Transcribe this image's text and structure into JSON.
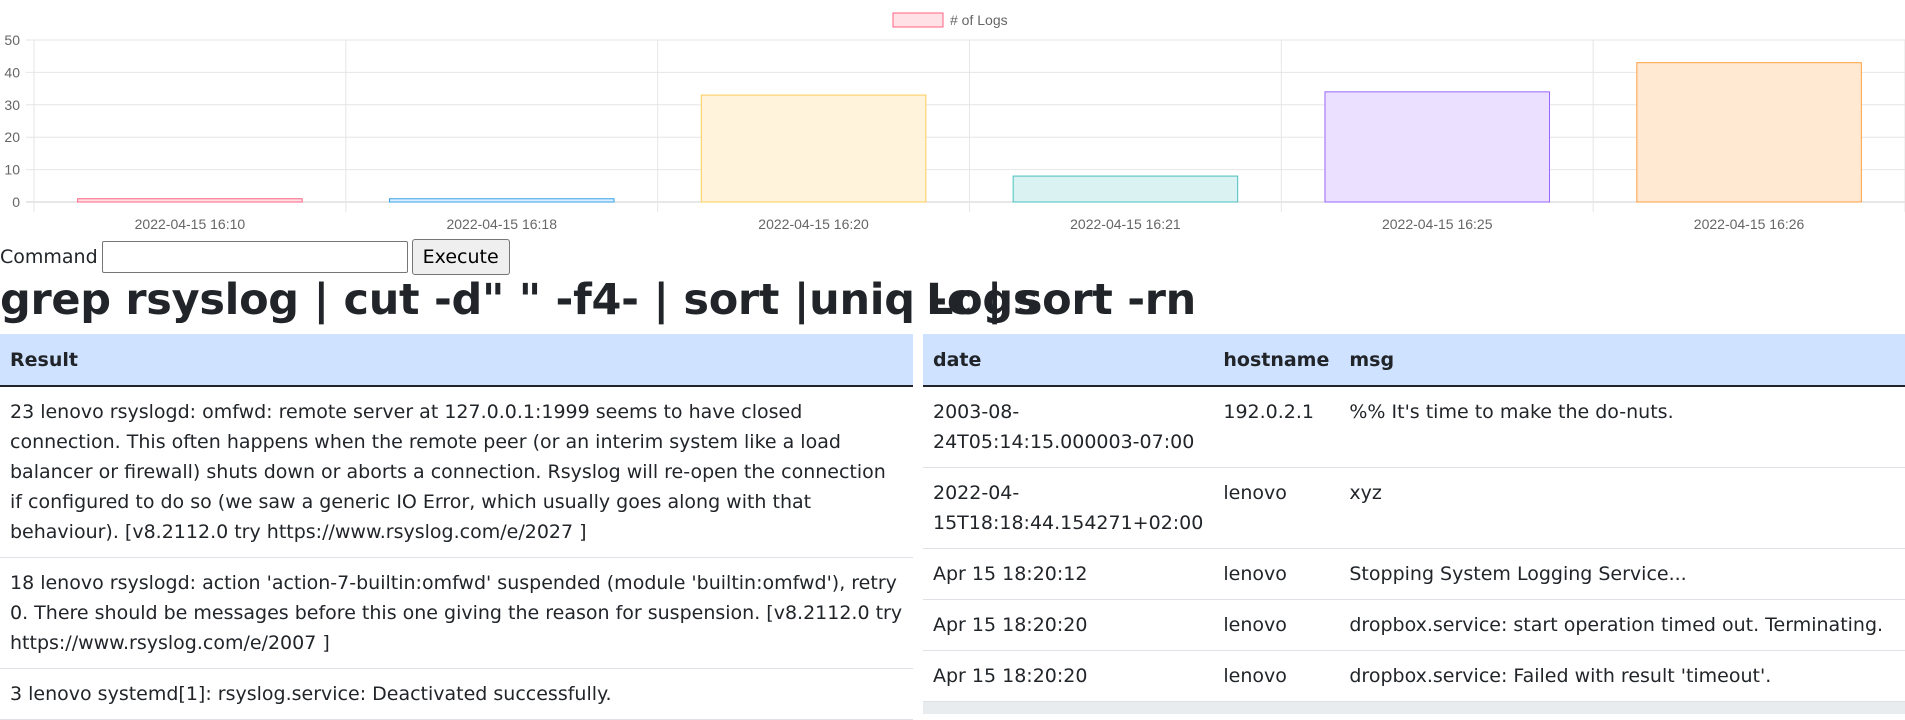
{
  "chart_data": {
    "type": "bar",
    "legend": "# of Logs",
    "categories": [
      "2022-04-15 16:10",
      "2022-04-15 16:18",
      "2022-04-15 16:20",
      "2022-04-15 16:21",
      "2022-04-15 16:25",
      "2022-04-15 16:26"
    ],
    "values": [
      1,
      1,
      33,
      8,
      34,
      43
    ],
    "ylim": [
      0,
      50
    ],
    "yticks": [
      0,
      10,
      20,
      30,
      40,
      50
    ],
    "grid": true,
    "legend_position": "top",
    "fills": [
      "#ffe1e6",
      "#dcefff",
      "#fff3dc",
      "#dbf2f2",
      "#ebe0ff",
      "#ffe9d2"
    ],
    "strokes": [
      "#ff6384",
      "#36a2eb",
      "#ffcd56",
      "#4bc0c0",
      "#9966ff",
      "#ff9f40"
    ]
  },
  "command": {
    "label": "Command",
    "value": "",
    "button": "Execute"
  },
  "left_heading": "grep rsyslog | cut -d\" \" -f4- | sort |uniq -c | sort -rn",
  "right_heading": "Logs",
  "result_table": {
    "header": "Result",
    "rows": [
      "23 lenovo rsyslogd: omfwd: remote server at 127.0.0.1:1999 seems to have closed connection. This often happens when the remote peer (or an interim system like a load balancer or firewall) shuts down or aborts a connection. Rsyslog will re-open the connection if configured to do so (we saw a generic IO Error, which usually goes along with that behaviour). [v8.2112.0 try https://www.rsyslog.com/e/2027 ]",
      "18 lenovo rsyslogd: action 'action-7-builtin:omfwd' suspended (module 'builtin:omfwd'), retry 0. There should be messages before this one giving the reason for suspension. [v8.2112.0 try https://www.rsyslog.com/e/2007 ]",
      "3 lenovo systemd[1]: rsyslog.service: Deactivated successfully."
    ]
  },
  "logs_table": {
    "headers": [
      "date",
      "hostname",
      "msg"
    ],
    "rows": [
      [
        "2003-08-24T05:14:15.000003-07:00",
        "192.0.2.1",
        "%% It's time to make the do-nuts."
      ],
      [
        "2022-04-15T18:18:44.154271+02:00",
        "lenovo",
        "xyz"
      ],
      [
        "Apr 15 18:20:12",
        "lenovo",
        "Stopping System Logging Service..."
      ],
      [
        "Apr 15 18:20:20",
        "lenovo",
        "dropbox.service: start operation timed out. Terminating."
      ],
      [
        "Apr 15 18:20:20",
        "lenovo",
        "dropbox.service: Failed with result 'timeout'."
      ]
    ]
  }
}
